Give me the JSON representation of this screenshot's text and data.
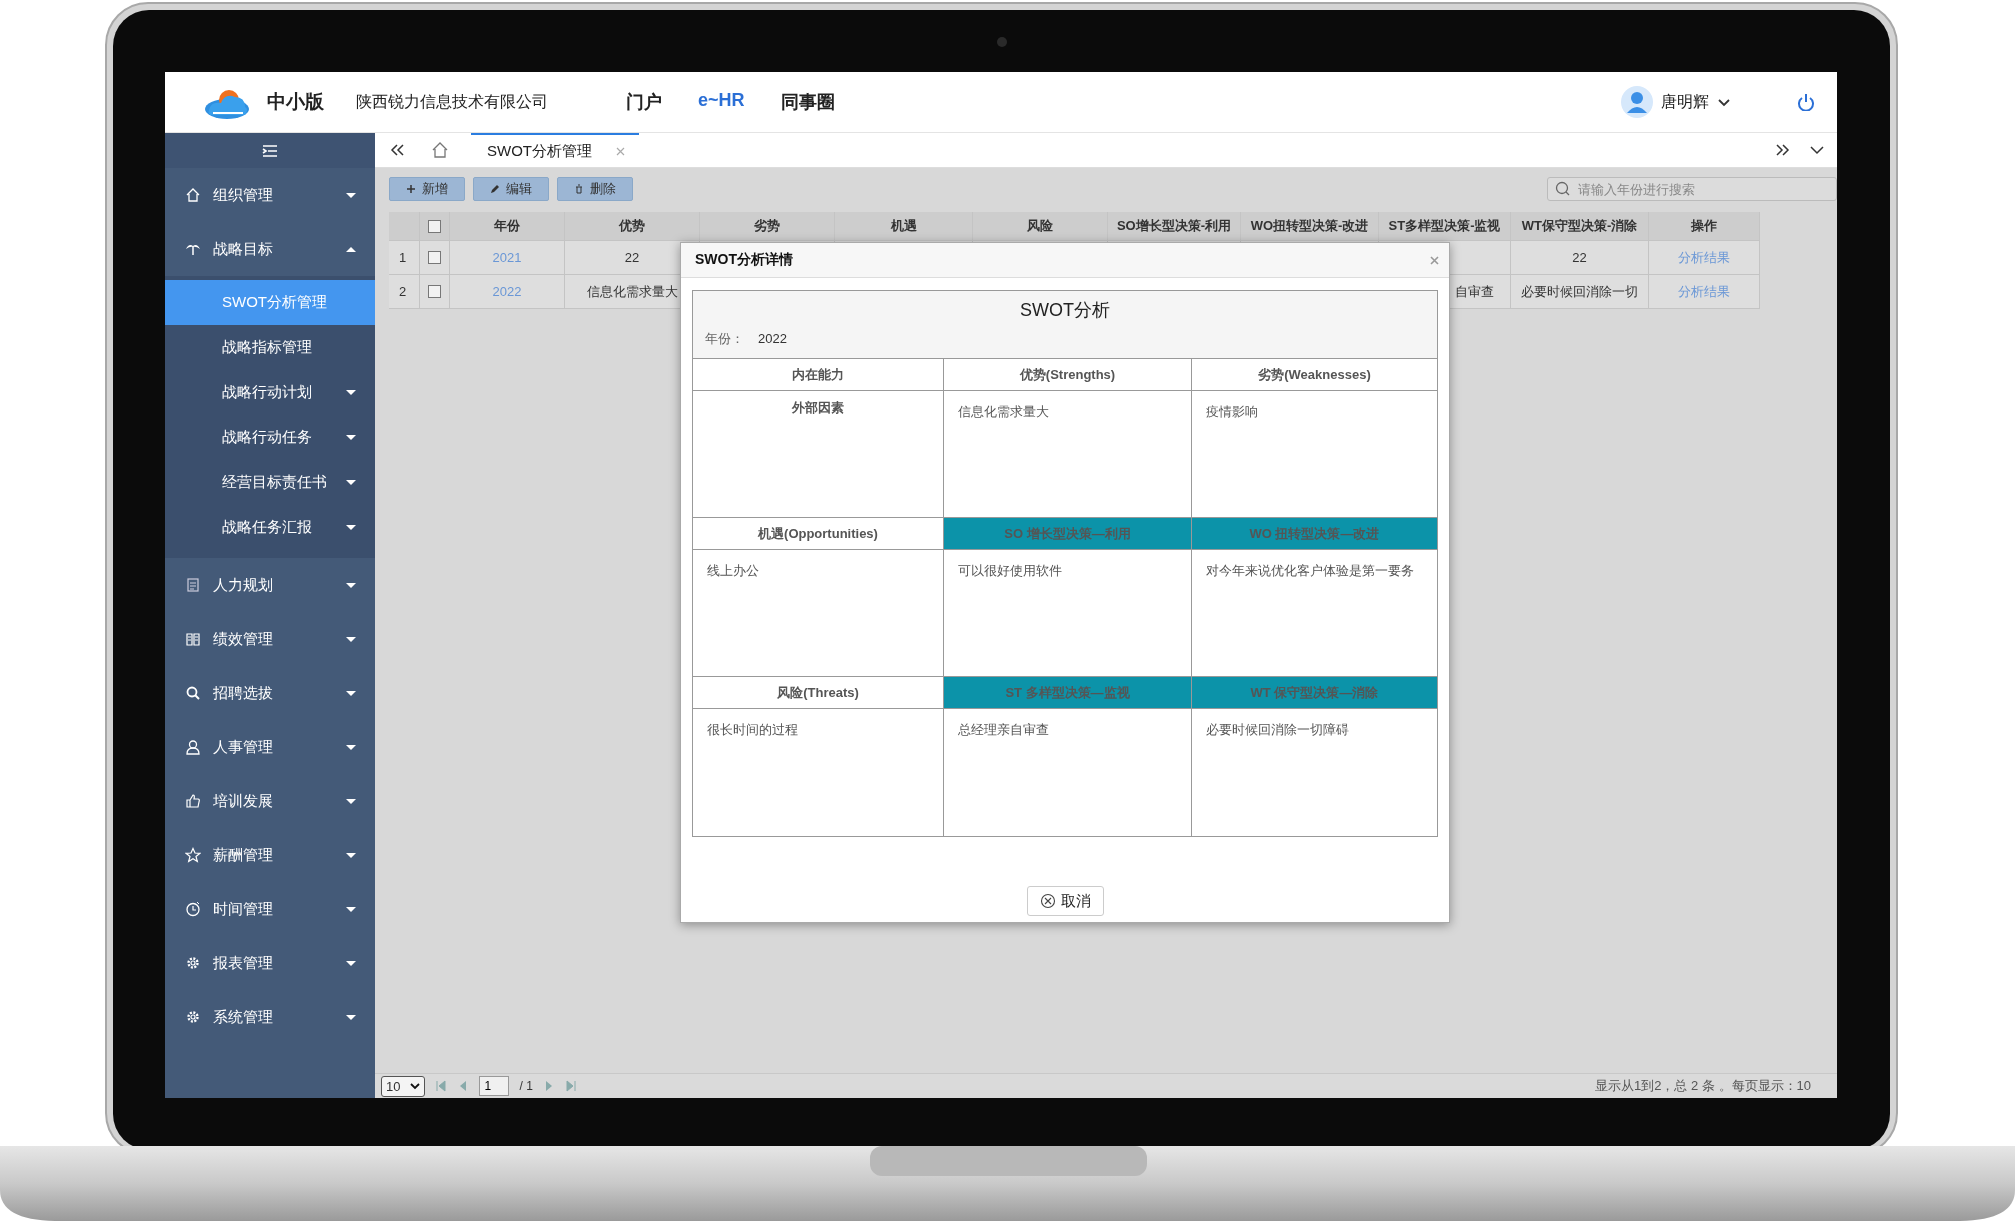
{
  "header": {
    "edition": "中小版",
    "company": "陕西锐力信息技术有限公司",
    "nav": [
      {
        "label": "门户",
        "selected": false
      },
      {
        "label": "e~HR",
        "selected": true
      },
      {
        "label": "同事圈",
        "selected": false
      }
    ],
    "user": "唐明辉"
  },
  "sidebar": {
    "items": [
      {
        "label": "组织管理",
        "expanded": false
      },
      {
        "label": "战略目标",
        "expanded": true,
        "children": [
          {
            "label": "SWOT分析管理",
            "selected": true,
            "expandable": false
          },
          {
            "label": "战略指标管理",
            "selected": false,
            "expandable": false
          },
          {
            "label": "战略行动计划",
            "selected": false,
            "expandable": true
          },
          {
            "label": "战略行动任务",
            "selected": false,
            "expandable": true
          },
          {
            "label": "经营目标责任书",
            "selected": false,
            "expandable": true
          },
          {
            "label": "战略任务汇报",
            "selected": false,
            "expandable": true
          }
        ]
      },
      {
        "label": "人力规划",
        "expanded": false
      },
      {
        "label": "绩效管理",
        "expanded": false
      },
      {
        "label": "招聘选拔",
        "expanded": false
      },
      {
        "label": "人事管理",
        "expanded": false
      },
      {
        "label": "培训发展",
        "expanded": false
      },
      {
        "label": "薪酬管理",
        "expanded": false
      },
      {
        "label": "时间管理",
        "expanded": false
      },
      {
        "label": "报表管理",
        "expanded": false
      },
      {
        "label": "系统管理",
        "expanded": false
      }
    ]
  },
  "tabs": [
    {
      "label": "SWOT分析管理",
      "selected": true
    }
  ],
  "toolbar": {
    "buttons": [
      "新增",
      "编辑",
      "删除"
    ],
    "search": {
      "placeholder": "请输入年份进行搜索"
    }
  },
  "table": {
    "select_all": {
      "checked": false
    },
    "columns": [
      "年份",
      "优势",
      "劣势",
      "机遇",
      "风险",
      "SO增长型决策-利用",
      "WO扭转型决策-改进",
      "ST多样型决策-监视",
      "WT保守型决策-消除",
      "操作"
    ],
    "rows": [
      {
        "number": "1",
        "checked": false,
        "year": "2021",
        "strengths": "22",
        "wt": "22",
        "action": "分析结果"
      },
      {
        "number": "2",
        "checked": false,
        "year": "2022",
        "strengths": "信息化需求量大",
        "st": "自审查",
        "wt": "必要时候回消除一切",
        "action": "分析结果"
      }
    ]
  },
  "pager": {
    "page_size": "10",
    "page": "1",
    "total": "/ 1",
    "summary": "显示从1到2，总 2 条 。每页显示：10"
  },
  "dialog": {
    "title": "SWOT分析详情",
    "heading": "SWOT分析",
    "year_label": "年份：",
    "year": "2022",
    "grid": [
      [
        {
          "kind": "label",
          "text": "内在能力"
        },
        {
          "kind": "label",
          "text": "优势(Strengths)"
        },
        {
          "kind": "label",
          "text": "劣势(Weaknesses)"
        }
      ],
      [
        {
          "kind": "label",
          "text": "外部因素"
        },
        {
          "kind": "text",
          "text": "信息化需求量大"
        },
        {
          "kind": "text",
          "text": "疫情影响"
        }
      ],
      [
        {
          "kind": "label",
          "text": "机遇(Opportunities)"
        },
        {
          "kind": "strategy",
          "text": "SO 增长型决策—利用"
        },
        {
          "kind": "strategy",
          "text": "WO 扭转型决策—改进"
        }
      ],
      [
        {
          "kind": "text",
          "text": "线上办公"
        },
        {
          "kind": "text",
          "text": "可以很好使用软件"
        },
        {
          "kind": "text",
          "text": "对今年来说优化客户体验是第一要务"
        }
      ],
      [
        {
          "kind": "label",
          "text": "风险(Threats)"
        },
        {
          "kind": "strategy",
          "text": "ST 多样型决策—监视"
        },
        {
          "kind": "strategy",
          "text": "WT 保守型决策—消除"
        }
      ],
      [
        {
          "kind": "text",
          "text": "很长时间的过程"
        },
        {
          "kind": "text",
          "text": "总经理亲自审查"
        },
        {
          "kind": "text",
          "text": "必要时候回消除一切障碍"
        }
      ]
    ],
    "cancel": "取消"
  }
}
